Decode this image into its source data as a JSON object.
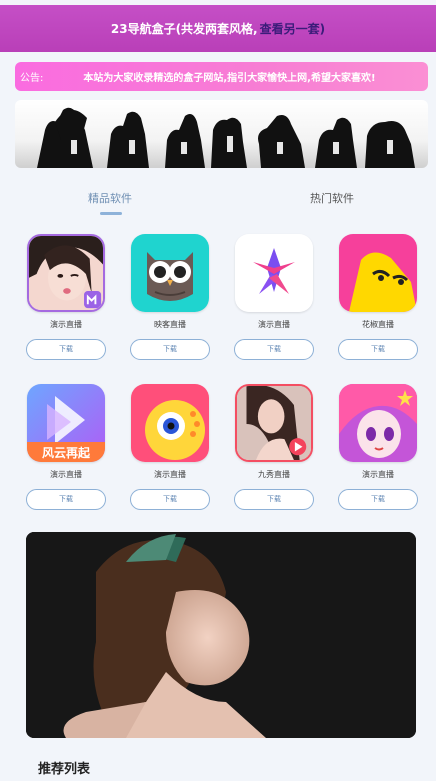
{
  "header": {
    "title": "23导航盒子(共发两套风格,",
    "link": "查看另一套)"
  },
  "notice": {
    "label": "公告:",
    "message": "本站为大家收录精选的盒子网站,指引大家愉快上网,希望大家喜欢!"
  },
  "tabs": [
    "精品软件",
    "热门软件"
  ],
  "apps": [
    {
      "name": "演示直播",
      "download": "下载",
      "icon": "girl-portrait-icon"
    },
    {
      "name": "映客直播",
      "download": "下载",
      "icon": "owl-icon"
    },
    {
      "name": "演示直播",
      "download": "下载",
      "icon": "star-logo-icon"
    },
    {
      "name": "花椒直播",
      "download": "下载",
      "icon": "pepper-face-icon"
    },
    {
      "name": "演示直播",
      "download": "下载",
      "icon": "play-triangle-icon",
      "badge": "风云再起"
    },
    {
      "name": "演示直播",
      "download": "下载",
      "icon": "eye-chick-icon"
    },
    {
      "name": "九秀直播",
      "download": "下载",
      "icon": "woman-photo-icon"
    },
    {
      "name": "演示直播",
      "download": "下载",
      "icon": "anime-girl-icon"
    }
  ],
  "section": {
    "title": "推荐列表"
  },
  "colors": {
    "header": "#c54fc6",
    "notice": "#fa6ce0",
    "accent": "#8eb2d9",
    "background": "#f2f5fa"
  }
}
